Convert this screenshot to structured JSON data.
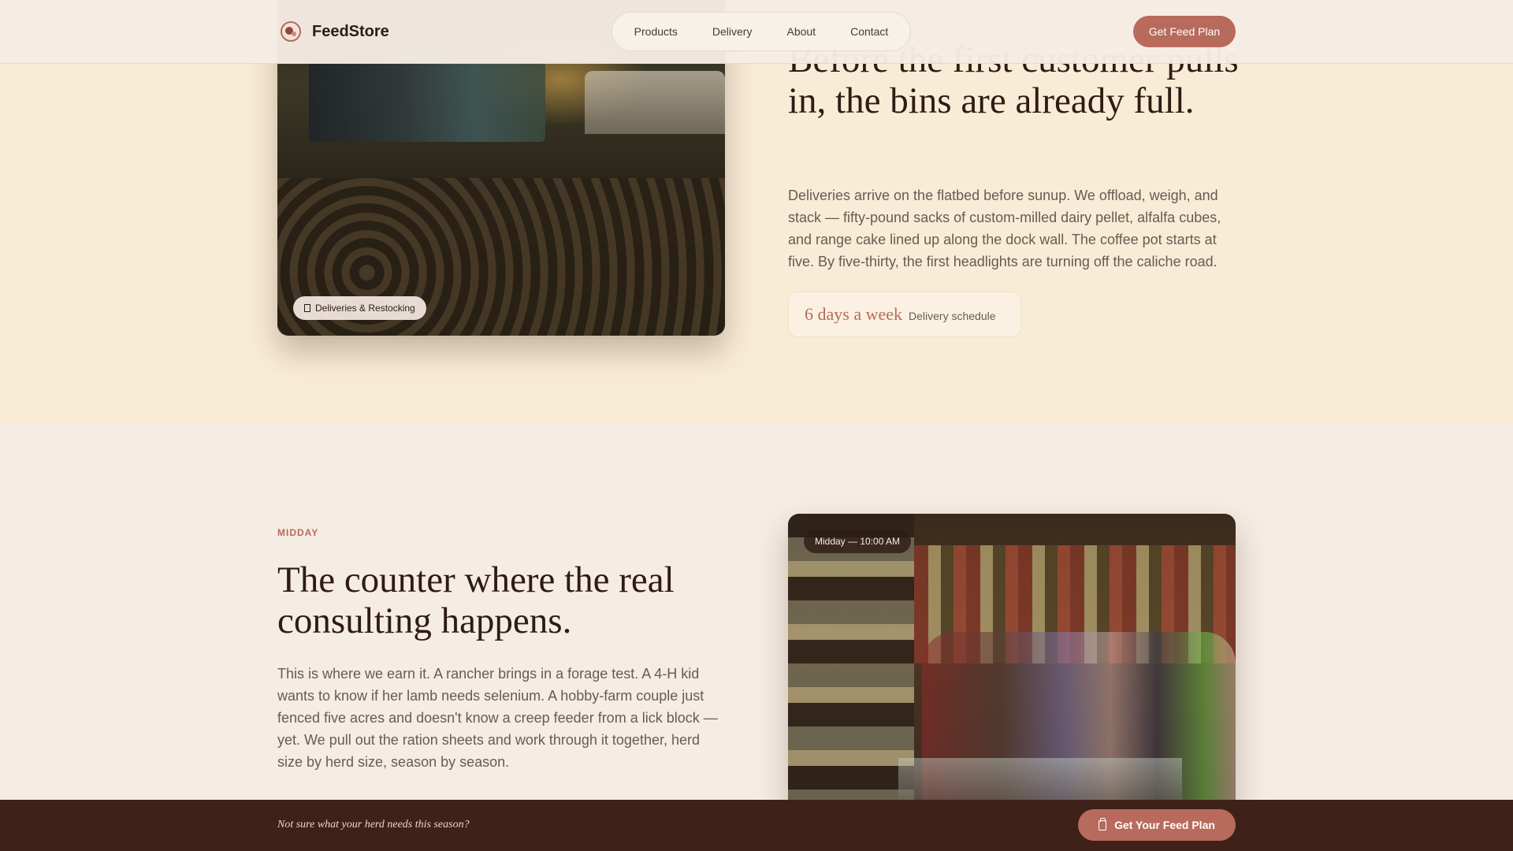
{
  "header": {
    "brand": "FeedStore",
    "logo_icon": "feed-bowl-icon",
    "nav": [
      "Products",
      "Delivery",
      "About",
      "Contact"
    ],
    "cta": "Get Feed Plan"
  },
  "dawn": {
    "photo_tag": "Deliveries & Restocking",
    "photo_tag_icon": "calendar-icon",
    "headline": "Before the first customer pulls in, the bins are already full.",
    "body": "Deliveries arrive on the flatbed before sunup. We offload, weigh, and stack — fifty-pound sacks of custom-milled dairy pellet, alfalfa cubes, and range cake lined up along the dock wall. The coffee pot starts at five. By five-thirty, the first headlights are turning off the caliche road.",
    "stat_value": "6 days a week",
    "stat_label": "Delivery schedule"
  },
  "midday": {
    "eyebrow": "MIDDAY",
    "headline": "The counter where the real consulting happens.",
    "body": "This is where we earn it. A rancher brings in a forage test. A 4-H kid wants to know if her lamb needs selenium. A hobby-farm couple just fenced five acres and doesn't know a creep feeder from a lick block — yet. We pull out the ration sheets and work through it together, herd size by herd size, season by season.",
    "photo_tag": "Midday — 10:00 AM"
  },
  "bottom_bar": {
    "prompt": "Not sure what your herd needs this season?",
    "cta": "Get Your Feed Plan",
    "cta_icon": "clipboard-icon"
  },
  "colors": {
    "accent": "#b86a5c",
    "dark": "#3e2119",
    "dawn_bg": "#f9ecd7",
    "page_bg": "#f5ece4"
  }
}
